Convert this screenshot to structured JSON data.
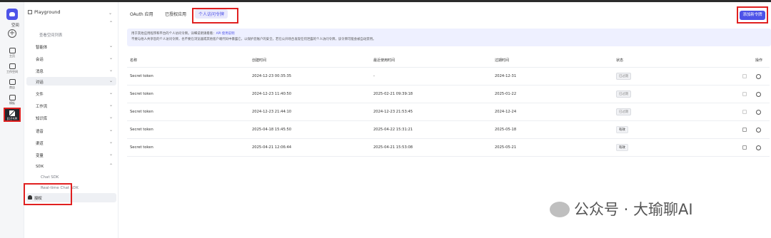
{
  "sidebar": {
    "section_title": "Playground",
    "items": [
      {
        "label": "空间"
      },
      {
        "label": "查看空间列表"
      },
      {
        "label": "智能体"
      },
      {
        "label": "会话"
      },
      {
        "label": "消息"
      },
      {
        "label": "对话"
      },
      {
        "label": "文件"
      },
      {
        "label": "工作流"
      },
      {
        "label": "知识库"
      },
      {
        "label": "语音"
      },
      {
        "label": "渠道"
      },
      {
        "label": "变量"
      },
      {
        "label": "SDK"
      },
      {
        "label": "Chat SDK"
      },
      {
        "label": "Real-time Chat SDK"
      }
    ],
    "auth_label": "授权"
  },
  "rail": {
    "items": [
      {
        "label": "主页"
      },
      {
        "label": "工作空间"
      },
      {
        "label": "商店"
      },
      {
        "label": "模板"
      },
      {
        "label": "扣子API"
      }
    ]
  },
  "tabs": [
    {
      "label": "OAuth 应用"
    },
    {
      "label": "已授权应用"
    },
    {
      "label": "个人访问令牌"
    }
  ],
  "toolbar": {
    "add_token_label": "添加新令牌"
  },
  "notice": {
    "line1": "用于其他应用程序和平台的个人访问令牌。详细说明请看看：",
    "link": "API 使用说明",
    "line2": "不要与他人共享您的个人访问令牌，也不要在浏览器或其他客户端代码中暴露它，以保护您账户的安全。若在公开场合发现任何泄露的个人访问令牌，该令牌可能会被自动禁用。"
  },
  "table": {
    "headers": [
      "名称",
      "创建时间",
      "最近使用时间",
      "过期时间",
      "状态",
      "操作"
    ],
    "rows": [
      {
        "name": "Secret token",
        "created": "2024-12-23 00:35:35",
        "last_used": "-",
        "expires": "2024-12-31",
        "status": "已过期"
      },
      {
        "name": "Secret token",
        "created": "2024-12-23 11:40:50",
        "last_used": "2025-02-21 09:39:18",
        "expires": "2025-01-22",
        "status": "已过期"
      },
      {
        "name": "Secret token",
        "created": "2024-12-23 21:44:10",
        "last_used": "2024-12-23 21:53:45",
        "expires": "2024-12-24",
        "status": "已过期"
      },
      {
        "name": "Secret token",
        "created": "2025-04-18 15:45:50",
        "last_used": "2025-04-22 15:31:21",
        "expires": "2025-05-18",
        "status": "有效"
      },
      {
        "name": "Secret token",
        "created": "2025-04-21 12:06:44",
        "last_used": "2025-04-21 15:53:08",
        "expires": "2025-05-21",
        "status": "有效"
      }
    ]
  },
  "watermark": "公众号 · 大瑜聊AI",
  "colors": {
    "accent": "#4d53e8",
    "highlight_box": "#e02020",
    "notice_bg": "#eef0ff"
  }
}
